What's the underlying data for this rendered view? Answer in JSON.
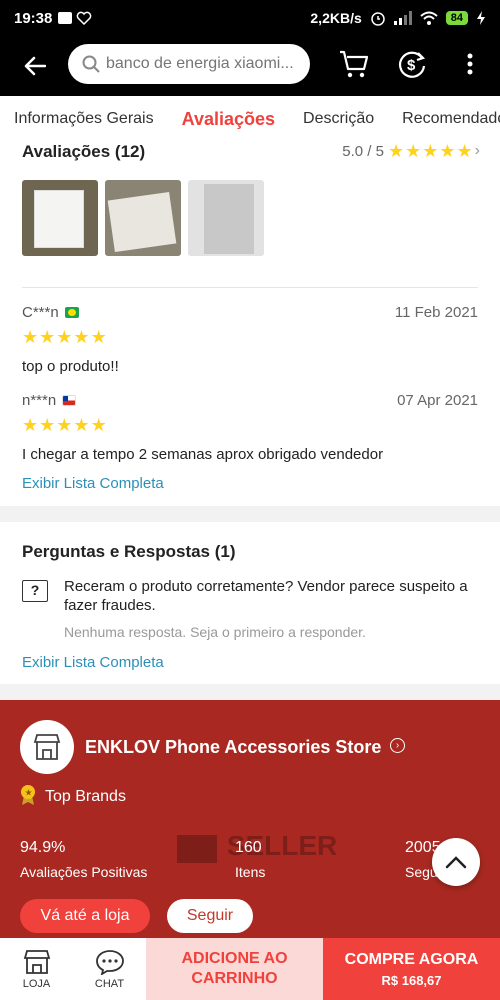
{
  "status_bar": {
    "time": "19:38",
    "net_speed": "2,2KB/s",
    "battery": "84"
  },
  "header": {
    "search_placeholder": "banco de energia xiaomi..."
  },
  "tabs": [
    {
      "label": "Informações Gerais"
    },
    {
      "label": "Avaliações"
    },
    {
      "label": "Descrição"
    },
    {
      "label": "Recomendado"
    }
  ],
  "reviews": {
    "title": "Avaliações (12)",
    "score": "5.0 / 5",
    "items": [
      {
        "user": "C***n",
        "country": "BR",
        "date": "11 Feb 2021",
        "stars": 5,
        "text": "top o produto!!"
      },
      {
        "user": "n***n",
        "country": "CL",
        "date": "07 Apr 2021",
        "stars": 5,
        "text": "I chegar a tempo 2 semanas aprox obrigado vendedor"
      }
    ],
    "view_all": "Exibir Lista Completa"
  },
  "qa": {
    "title": "Perguntas e Respostas (1)",
    "question": "Receram o produto corretamente? Vendor parece suspeito a fazer fraudes.",
    "no_answer": "Nenhuma resposta. Seja o primeiro a responder.",
    "view_all": "Exibir Lista Completa"
  },
  "store": {
    "name": "ENKLOV Phone Accessories Store",
    "badge": "Top Brands",
    "stats": [
      {
        "value": "94.9%",
        "label": "Avaliações Positivas"
      },
      {
        "value": "160",
        "label": "Itens"
      },
      {
        "value": "2005",
        "label": "Seguidores"
      }
    ],
    "watermark": "SELLER",
    "go_button": "Vá até a loja",
    "follow_button": "Seguir"
  },
  "bottom_bar": {
    "store_label": "LOJA",
    "chat_label": "CHAT",
    "add_cart": "ADICIONE AO CARRINHO",
    "buy_now": "COMPRE AGORA",
    "price": "R$ 168,67"
  },
  "colors": {
    "accent": "#f0413c",
    "store_bg": "#a92922",
    "link": "#2c8fb8",
    "star": "#ffd21f"
  }
}
